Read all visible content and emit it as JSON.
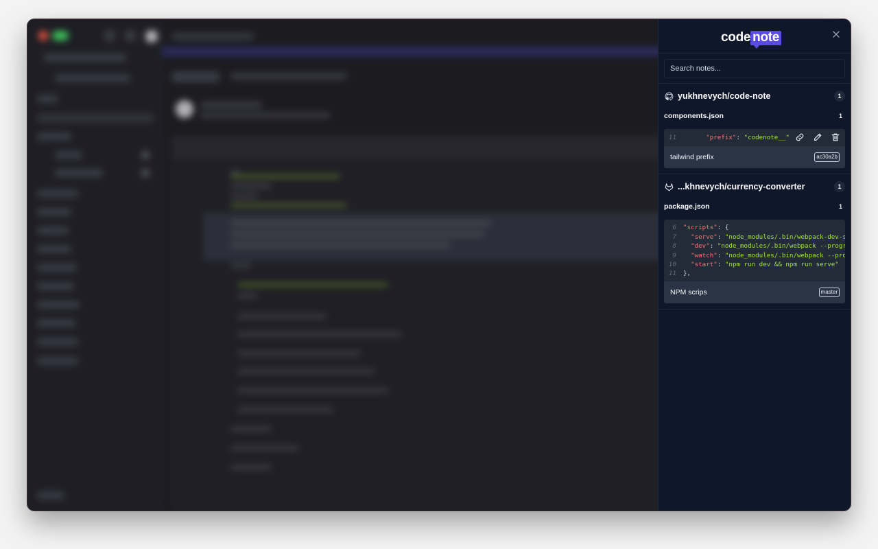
{
  "panel": {
    "logo": {
      "part1": "code",
      "part2": "note"
    },
    "close_icon": "close-icon",
    "search": {
      "placeholder": "Search notes...",
      "value": ""
    },
    "repos": [
      {
        "provider_icon": "github-icon",
        "name": "yukhnevych/code-note",
        "count": "1",
        "files": [
          {
            "name": "components.json",
            "count": "1",
            "notes": [
              {
                "title": "tailwind prefix",
                "ref": "ac30a2b",
                "lines": [
                  {
                    "n": "11",
                    "indent": "      ",
                    "key": "\"prefix\"",
                    "sep": ": ",
                    "val": "\"codenote__\"",
                    "tail": ""
                  }
                ],
                "actions": [
                  "link-icon",
                  "pencil-icon",
                  "trash-icon"
                ]
              }
            ]
          }
        ]
      },
      {
        "provider_icon": "gitlab-icon",
        "name": "...khnevych/currency-converter",
        "count": "1",
        "files": [
          {
            "name": "package.json",
            "count": "1",
            "notes": [
              {
                "title": "NPM scrips",
                "ref": "master",
                "lines": [
                  {
                    "n": "6",
                    "indent": "",
                    "key": "\"scripts\"",
                    "sep": ": ",
                    "val": "",
                    "tail": "{"
                  },
                  {
                    "n": "7",
                    "indent": "  ",
                    "key": "\"serve\"",
                    "sep": ": ",
                    "val": "\"node_modules/.bin/webpack-dev-s",
                    "tail": ""
                  },
                  {
                    "n": "8",
                    "indent": "  ",
                    "key": "\"dev\"",
                    "sep": ": ",
                    "val": "\"node_modules/.bin/webpack --progr",
                    "tail": ""
                  },
                  {
                    "n": "9",
                    "indent": "  ",
                    "key": "\"watch\"",
                    "sep": ": ",
                    "val": "\"node_modules/.bin/webpack --pro",
                    "tail": ""
                  },
                  {
                    "n": "10",
                    "indent": "  ",
                    "key": "\"start\"",
                    "sep": ": ",
                    "val": "\"npm run dev && npm run serve\"",
                    "tail": ""
                  },
                  {
                    "n": "11",
                    "indent": "",
                    "key": "",
                    "sep": "",
                    "val": "",
                    "tail": "},"
                  }
                ]
              }
            ]
          }
        ]
      }
    ]
  },
  "colors": {
    "panel_bg": "#0f172a",
    "logo_accent": "#5b4ce0",
    "code_key": "#f87171",
    "code_string": "#a3e635"
  }
}
